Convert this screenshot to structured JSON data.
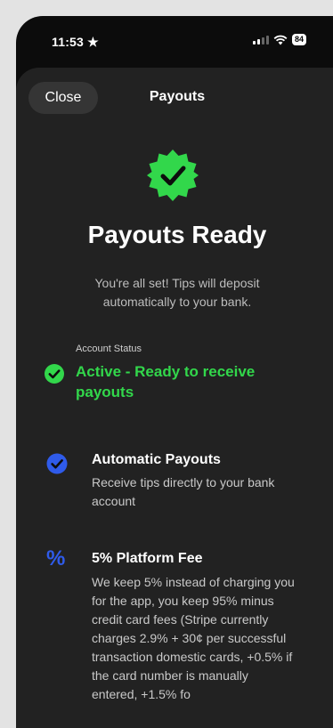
{
  "status_bar": {
    "time": "11:53",
    "location_icon": "star-icon",
    "wifi_icon": "wifi-icon",
    "battery_level": "84"
  },
  "header": {
    "close_label": "Close",
    "title": "Payouts"
  },
  "hero": {
    "badge_icon": "verified-check-badge-icon",
    "badge_color": "#32d74b",
    "headline": "Payouts Ready",
    "subtitle": "You're all set! Tips will deposit automatically to your bank."
  },
  "account_status": {
    "label": "Account Status",
    "value": "Active - Ready to receive payouts",
    "color": "#32d74b"
  },
  "features": [
    {
      "icon": "check-circle-icon",
      "icon_color": "#2f5bea",
      "title": "Automatic Payouts",
      "description": "Receive tips directly to your bank account"
    },
    {
      "icon": "percent-icon",
      "icon_glyph": "%",
      "icon_color": "#2f5bea",
      "title": "5% Platform Fee",
      "description": "We keep 5% instead of charging you for the app, you keep 95% minus credit card fees (Stripe currently charges 2.9% + 30¢ per successful transaction domestic cards, +0.5% if the card number is manually entered, +1.5% fo"
    }
  ]
}
